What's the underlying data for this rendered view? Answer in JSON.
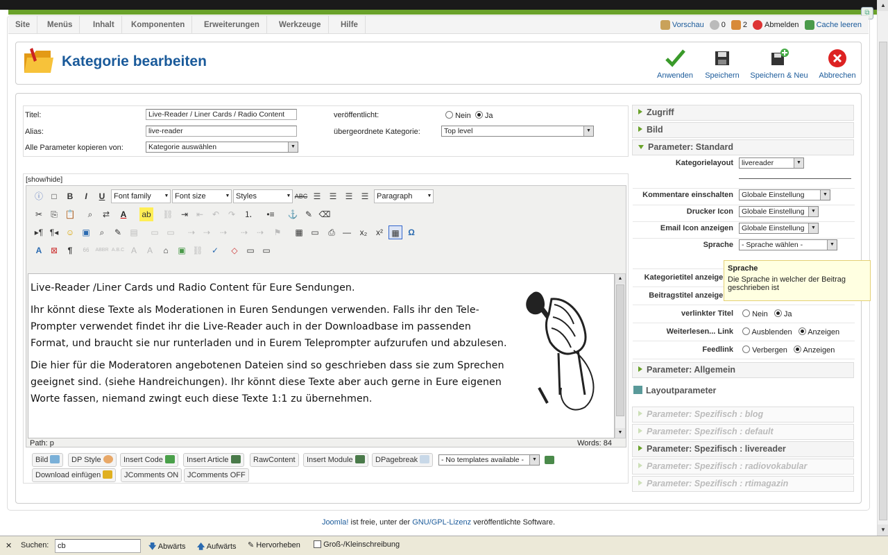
{
  "menu": [
    "Site",
    "Menüs",
    "Inhalt",
    "Komponenten",
    "Erweiterungen",
    "Werkzeuge",
    "Hilfe"
  ],
  "status": {
    "preview": "Vorschau",
    "messages": "0",
    "users": "2",
    "logout": "Abmelden",
    "cache": "Cache leeren"
  },
  "page_title": "Kategorie bearbeiten",
  "toolbar": {
    "apply": "Anwenden",
    "save": "Speichern",
    "save_new": "Speichern & Neu",
    "cancel": "Abbrechen"
  },
  "details": {
    "title_label": "Titel:",
    "title_value": "Live-Reader / Liner Cards / Radio Content",
    "alias_label": "Alias:",
    "alias_value": "live-reader",
    "copy_label": "Alle Parameter kopieren von:",
    "copy_value": "Kategorie auswählen",
    "published_label": "veröffentlicht:",
    "no": "Nein",
    "yes": "Ja",
    "parent_label": "übergeordnete Kategorie:",
    "parent_value": "Top level"
  },
  "editor": {
    "showhide": "[show/hide]",
    "font_family": "Font family",
    "font_size": "Font size",
    "styles": "Styles",
    "format": "Paragraph",
    "paragraphs": [
      "Live-Reader /Liner Cards und Radio Content für Eure Sendungen.",
      "Ihr könnt diese Texte als Moderationen in Euren Sendungen verwenden. Falls ihr den Tele-Prompter verwendet findet ihr die Live-Reader auch in der Downloadbase im passenden Format, und braucht sie nur runterladen und in Eurem Teleprompter aufzurufen und abzulesen.",
      "Die hier für die Moderatoren angebotenen Dateien sind so geschrieben dass sie zum Sprechen geeignet sind. (siehe Handreichungen). Ihr könnt diese Texte aber auch gerne in Eure eigenen Worte fassen, niemand zwingt euch diese Texte 1:1 zu übernehmen."
    ],
    "path": "Path: p",
    "words": "Words: 84"
  },
  "xtd": [
    "Bild",
    "DP Style",
    "Insert Code",
    "Insert Article",
    "RawContent",
    "Insert Module",
    "DPagebreak",
    "- No templates available -",
    "Download einfügen",
    "JComments ON",
    "JComments OFF"
  ],
  "panels": {
    "access": "Zugriff",
    "image": "Bild",
    "standard": "Parameter: Standard",
    "general": "Parameter: Allgemein",
    "layoutparam": "Layoutparameter",
    "blog": "Parameter: Spezifisch : blog",
    "default": "Parameter: Spezifisch : default",
    "livereader": "Parameter: Spezifisch : livereader",
    "radiovokabular": "Parameter: Spezifisch : radiovokabular",
    "rtimagazin": "Parameter: Spezifisch : rtimagazin"
  },
  "params": {
    "layout_label": "Kategorielayout",
    "layout_value": "livereader",
    "comments_label": "Kommentare einschalten",
    "global": "Globale Einstellung",
    "print_label": "Drucker Icon",
    "email_label": "Email Icon anzeigen",
    "lang_label": "Sprache",
    "lang_value": "- Sprache wählen -",
    "cattitle_label": "Kategorietitel anzeigen",
    "arttitle_label": "Beitragstitel anzeigen",
    "linked_label": "verlinkter Titel",
    "no": "Nein",
    "yes": "Ja",
    "readmore_label": "Weiterlesen... Link",
    "hide": "Ausblenden",
    "show": "Anzeigen",
    "feed_label": "Feedlink",
    "conceal": "Verbergen"
  },
  "tooltip": {
    "title": "Sprache",
    "text": "Die Sprache in welcher der Beitrag geschrieben ist"
  },
  "footer": {
    "joomla": "Joomla!",
    "mid": " ist freie, unter der ",
    "gpl": "GNU/GPL-Lizenz",
    "end": " veröffentlichte Software."
  },
  "findbar": {
    "label": "Suchen:",
    "value": "cb",
    "down": "Abwärts",
    "up": "Aufwärts",
    "highlight": "Hervorheben",
    "case": "Groß-/Kleinschreibung"
  }
}
